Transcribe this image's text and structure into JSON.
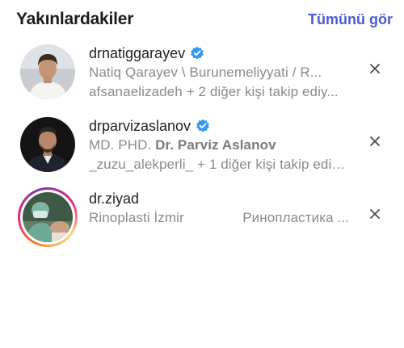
{
  "header": {
    "title": "Yakınlardakiler",
    "see_all_label": "Tümünü gör"
  },
  "suggestions": [
    {
      "username": "drnatiggarayev",
      "verified": true,
      "bio": "Natiq Qarayev \\ Burunemeliyyati / R...",
      "followed_by": "afsanaelizadeh + 2 diğer kişi takip ediy...",
      "avatar_icon": "profile-photo-man-in-white-shirt",
      "dismiss_icon": "close-icon"
    },
    {
      "username": "drparvizaslanov",
      "verified": true,
      "bio_prefix": "MD. PHD. ",
      "bio_bold": "Dr. Parviz Aslanov",
      "followed_by": "_zuzu_alekperli_ + 1 diğer kişi takip ediy...",
      "avatar_icon": "profile-photo-man-in-dark-suit",
      "dismiss_icon": "close-icon"
    },
    {
      "username": "dr.ziyad",
      "verified": false,
      "has_story_ring": true,
      "bio_left": "Rinoplasti İzmir",
      "bio_right": "Ринопластика ...",
      "avatar_icon": "profile-photo-surgeon",
      "dismiss_icon": "close-icon"
    }
  ],
  "colors": {
    "link": "#4a5bd4",
    "verified_badge": "#3897f0",
    "secondary_text": "#8a8a8a"
  }
}
